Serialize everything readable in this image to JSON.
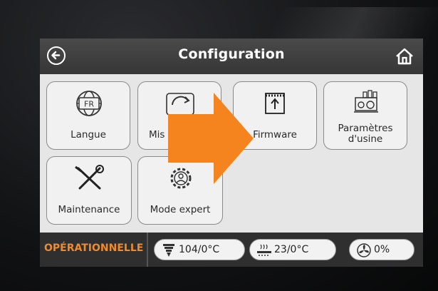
{
  "header": {
    "title": "Configuration"
  },
  "tiles": [
    {
      "label": "Langue",
      "icon": "globe-fr-icon",
      "badge": "FR"
    },
    {
      "label": "Mis",
      "icon": "refresh-icon"
    },
    {
      "label": "Firmware",
      "icon": "firmware-upload-icon"
    },
    {
      "label": "Paramètres\nd'usine",
      "line1": "Paramètres",
      "line2": "d'usine",
      "icon": "factory-settings-icon"
    },
    {
      "label": "Maintenance",
      "icon": "tools-icon"
    },
    {
      "label": "Mode expert",
      "icon": "expert-gear-icon"
    }
  ],
  "status_bar": {
    "state": "OPÉRATIONNELLE",
    "state_color": "#f08a2a",
    "nozzle_temp": "104/0°C",
    "bed_temp": "23/0°C",
    "fan": "0%"
  },
  "overlay": {
    "arrow_color": "#f5841f"
  }
}
